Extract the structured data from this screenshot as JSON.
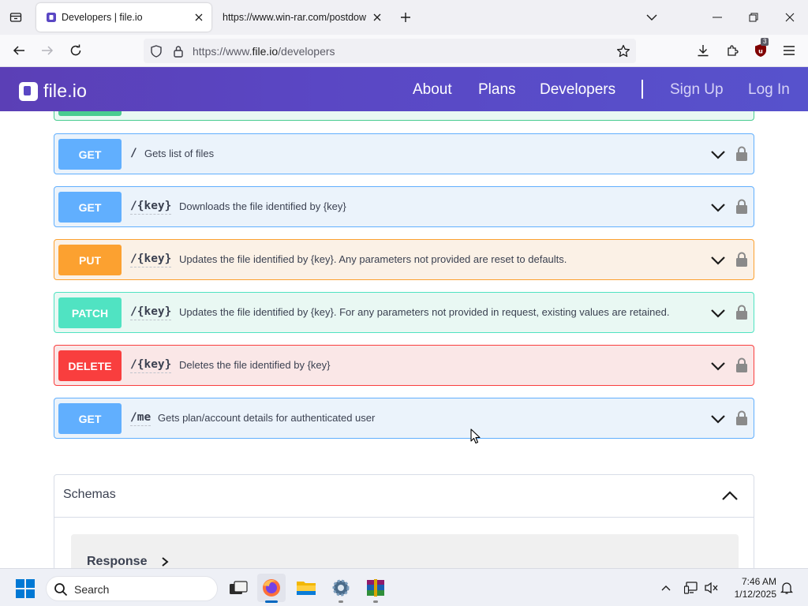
{
  "browser": {
    "tabs": [
      {
        "title": "Developers | file.io",
        "active": true
      },
      {
        "title": "https://www.win-rar.com/postdow",
        "active": false
      }
    ],
    "url_prefix": "https://www.",
    "url_domain": "file.io",
    "url_path": "/developers",
    "extension_badge": "3"
  },
  "site": {
    "logo_text": "file.io",
    "nav": [
      "About",
      "Plans",
      "Developers"
    ],
    "auth": [
      "Sign Up",
      "Log In"
    ]
  },
  "operations": [
    {
      "method": "GET",
      "path": "/",
      "description": "Gets list of files"
    },
    {
      "method": "GET",
      "path": "/{key}",
      "description": "Downloads the file identified by {key}"
    },
    {
      "method": "PUT",
      "path": "/{key}",
      "description": "Updates the file identified by {key}. Any parameters not provided are reset to defaults."
    },
    {
      "method": "PATCH",
      "path": "/{key}",
      "description": "Updates the file identified by {key}. For any parameters not provided in request, existing values are retained."
    },
    {
      "method": "DELETE",
      "path": "/{key}",
      "description": "Deletes the file identified by {key}"
    },
    {
      "method": "GET",
      "path": "/me",
      "description": "Gets plan/account details for authenticated user"
    }
  ],
  "schemas": {
    "title": "Schemas",
    "model": "Response"
  },
  "taskbar": {
    "search_label": "Search",
    "time": "7:46 AM",
    "date": "1/12/2025"
  },
  "colors": {
    "header_gradient_start": "#5b3fb6",
    "header_gradient_end": "#5752cc",
    "get": "#61affe",
    "put": "#fca130",
    "patch": "#50e3c2",
    "delete": "#f93e3e"
  }
}
